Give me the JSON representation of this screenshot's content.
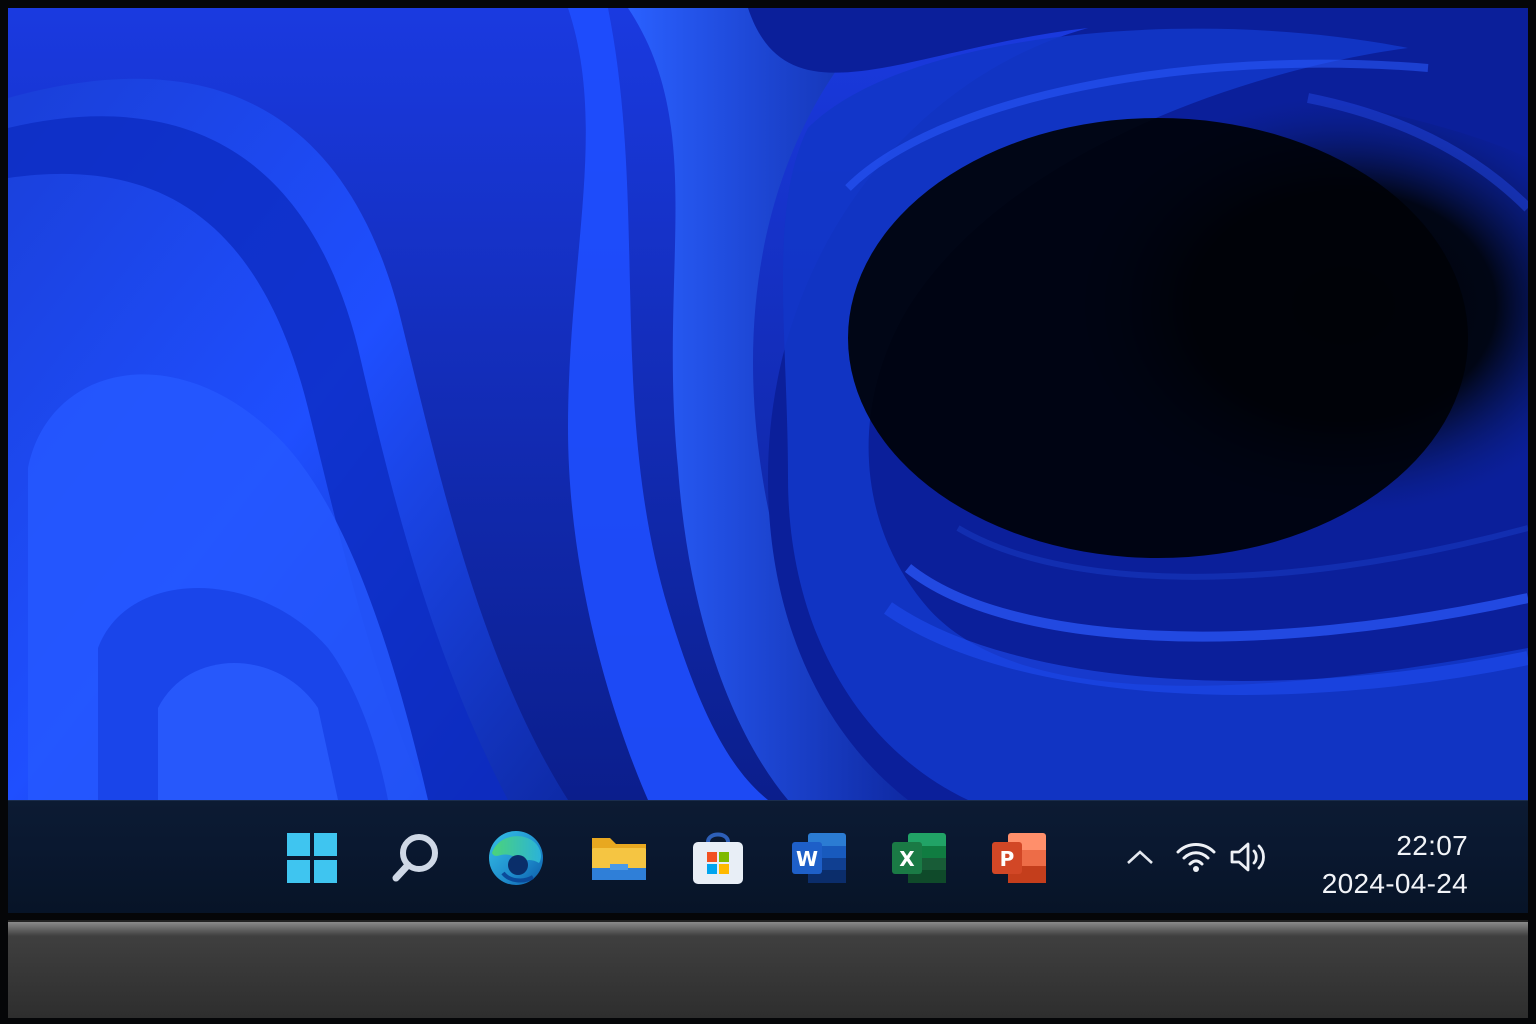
{
  "taskbar": {
    "apps": [
      {
        "name": "start",
        "icon": "windows-logo-icon",
        "color": "#3fc5f0"
      },
      {
        "name": "search",
        "icon": "search-icon",
        "color": "#cfd8e6"
      },
      {
        "name": "edge",
        "icon": "edge-icon",
        "color": "#2bb3d9"
      },
      {
        "name": "file-explorer",
        "icon": "folder-icon",
        "color": "#f5c542"
      },
      {
        "name": "microsoft-store",
        "icon": "store-icon",
        "color": "#e8eef6"
      },
      {
        "name": "word",
        "icon": "word-icon",
        "color": "#1e5fc8",
        "letter": "W"
      },
      {
        "name": "excel",
        "icon": "excel-icon",
        "color": "#1a7a45",
        "letter": "X"
      },
      {
        "name": "powerpoint",
        "icon": "powerpoint-icon",
        "color": "#d24726",
        "letter": "P"
      }
    ],
    "tray": {
      "overflow_icon": "chevron-up-icon",
      "wifi_icon": "wifi-icon",
      "volume_icon": "volume-icon"
    },
    "clock": {
      "time": "22:07",
      "date": "2024-04-24"
    }
  },
  "colors": {
    "wallpaper_primary": "#1f4fff",
    "wallpaper_dark": "#000614",
    "taskbar_bg": "#0a1830"
  }
}
